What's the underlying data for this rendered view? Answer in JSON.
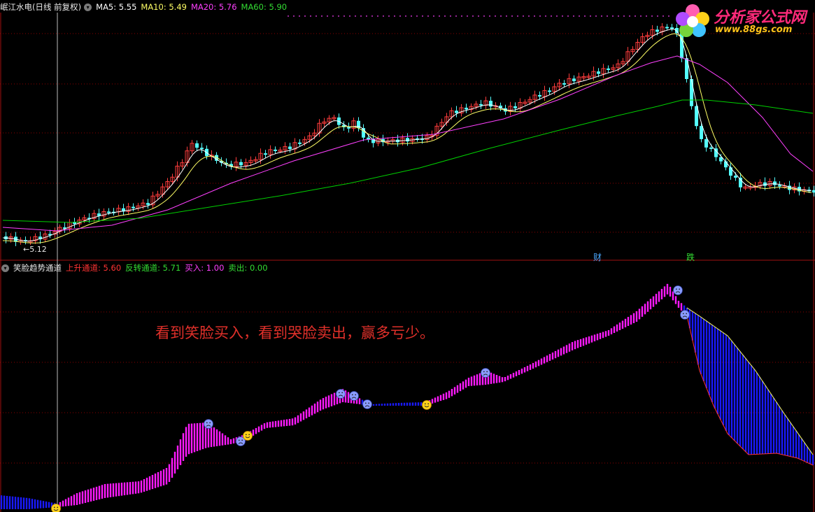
{
  "main_header": {
    "title": "岷江水电(日线 前复权)",
    "ma5": "MA5: 5.55",
    "ma10": "MA10: 5.49",
    "ma20": "MA20: 5.76",
    "ma60": "MA60: 5.90"
  },
  "sub_header": {
    "title": "笑脸趋势通道",
    "up": "上升通道: 5.60",
    "rev": "反转通道: 5.71",
    "buy": "买入: 1.00",
    "sell": "卖出: 0.00"
  },
  "annotation": "看到笑脸买入，看到哭脸卖出，赢多亏少。",
  "low_marker": "←5.12",
  "events": {
    "fin": "财",
    "down": "跌"
  },
  "logo": {
    "brand": "分析家公式网",
    "url": "www.88gs.com"
  },
  "colors": {
    "up_candle": "#ff3c3c",
    "down_candle": "#54ffff",
    "ma5": "#ffffff",
    "ma10": "#ffff66",
    "ma20": "#ff40ff",
    "ma60": "#00d000",
    "grid": "#8b0000",
    "ribbon_up": "#ff1aff",
    "ribbon_down": "#1a1aff"
  },
  "chart_data": [
    {
      "type": "candlestick",
      "title": "岷江水电(日线 前复权)",
      "annotations": [
        "←5.12",
        "财",
        "跌"
      ],
      "series": [
        {
          "name": "MA5",
          "value_shown": 5.55
        },
        {
          "name": "MA10",
          "value_shown": 5.49
        },
        {
          "name": "MA20",
          "value_shown": 5.76
        },
        {
          "name": "MA60",
          "value_shown": 5.9
        }
      ]
    },
    {
      "type": "area",
      "title": "笑脸趋势通道",
      "series": [
        {
          "name": "上升通道",
          "value_shown": 5.6
        },
        {
          "name": "反转通道",
          "value_shown": 5.71
        },
        {
          "name": "买入",
          "value_shown": 1.0
        },
        {
          "name": "卖出",
          "value_shown": 0.0
        }
      ]
    }
  ]
}
